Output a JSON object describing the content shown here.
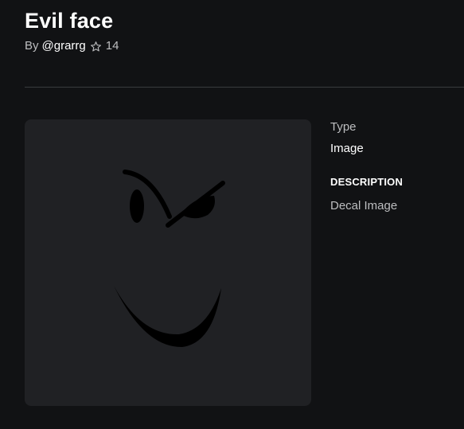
{
  "item": {
    "title": "Evil face",
    "by_label": "By",
    "creator": "@grarrg",
    "favorites_count": "14",
    "thumbnail_alt": "Evil face"
  },
  "details": {
    "type_label": "Type",
    "type_value": "Image",
    "description_heading": "DESCRIPTION",
    "description_text": "Decal Image"
  },
  "icons": {
    "favorite": "star-outline-icon"
  },
  "colors": {
    "background": "#111214",
    "thumbnail_background": "#202124",
    "secondary_text": "#bdbec0",
    "primary_text": "#ffffff",
    "divider": "#393b3d",
    "face_ink": "#000000"
  }
}
